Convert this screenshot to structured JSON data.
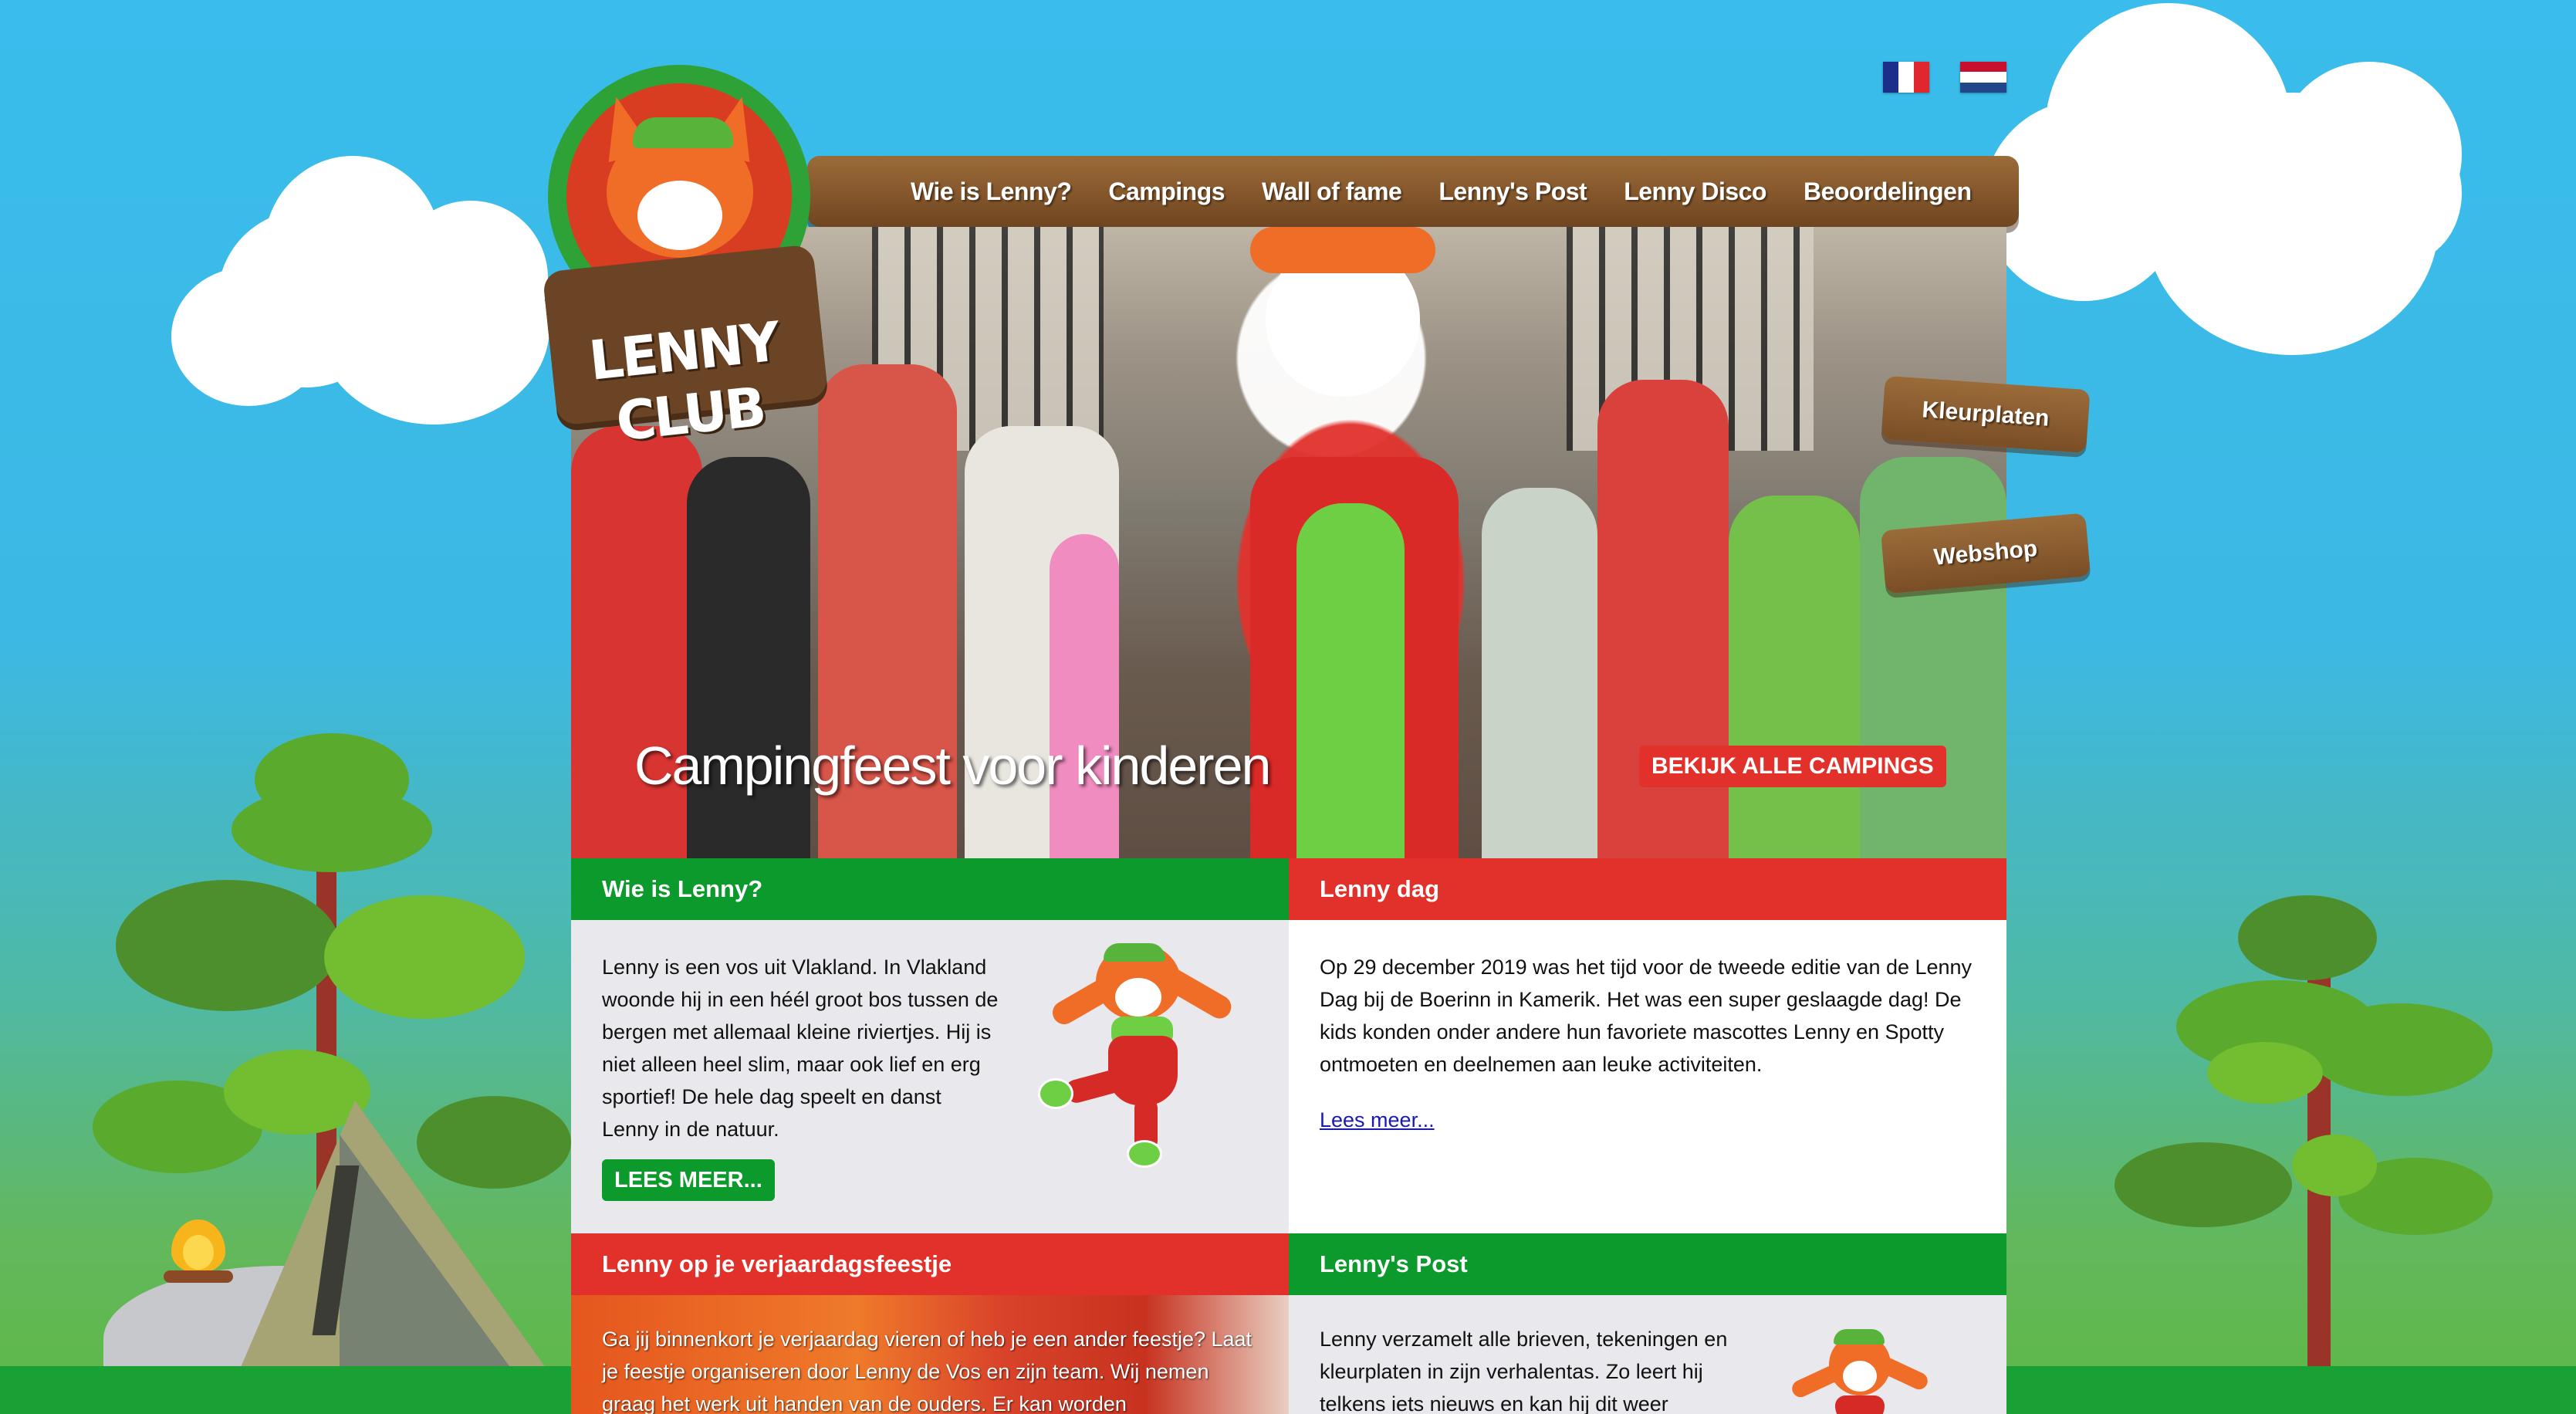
{
  "flags": [
    {
      "name": "flag-france",
      "colors": [
        "#1b2f8a",
        "#ffffff",
        "#e0262f"
      ]
    },
    {
      "name": "flag-netherlands",
      "colors": [
        "#c8102e",
        "#ffffff",
        "#21468b"
      ]
    }
  ],
  "logo": {
    "text": "LENNY CLUB"
  },
  "nav": {
    "items": [
      "Wie is Lenny?",
      "Campings",
      "Wall of fame",
      "Lenny's Post",
      "Lenny Disco",
      "Beoordelingen"
    ]
  },
  "hero": {
    "caption": "Campingfeest voor kinderen",
    "button": "BEKIJK ALLE CAMPINGS"
  },
  "side_buttons": {
    "kleurplaten": "Kleurplaten",
    "webshop": "Webshop"
  },
  "boxes": {
    "wie": {
      "title": "Wie is Lenny?",
      "text": "Lenny is een vos uit Vlakland. In Vlakland woonde hij in een héél groot bos tussen de bergen met allemaal kleine riviertjes. Hij is niet alleen heel slim, maar ook lief en erg sportief! De hele dag speelt en danst Lenny in de natuur.",
      "button": "LEES MEER..."
    },
    "dag": {
      "title": "Lenny dag",
      "text": "Op 29 december 2019 was het tijd voor de tweede editie van de Lenny Dag bij de Boerinn in Kamerik. Het was een super geslaagde dag! De kids konden onder andere hun favoriete mascottes Lenny en Spotty ontmoeten en deelnemen aan leuke activiteiten.",
      "link": "Lees meer..."
    },
    "verjaardag": {
      "title": "Lenny op je verjaardagsfeestje",
      "text": "Ga jij binnenkort je verjaardag vieren of heb je een ander feestje? Laat je feestje organiseren door Lenny de Vos en zijn team. Wij nemen graag het werk uit handen van de ouders. Er kan worden"
    },
    "post": {
      "title": "Lenny's Post",
      "text": "Lenny verzamelt alle brieven, tekeningen en kleurplaten in zijn verhalentas. Zo leert hij telkens iets nieuws en kan hij dit weer"
    }
  },
  "colors": {
    "sky": "#3abdec",
    "grass": "#19a133",
    "green": "#0b9a2b",
    "red": "#e2312a",
    "wood": "#84562b"
  }
}
